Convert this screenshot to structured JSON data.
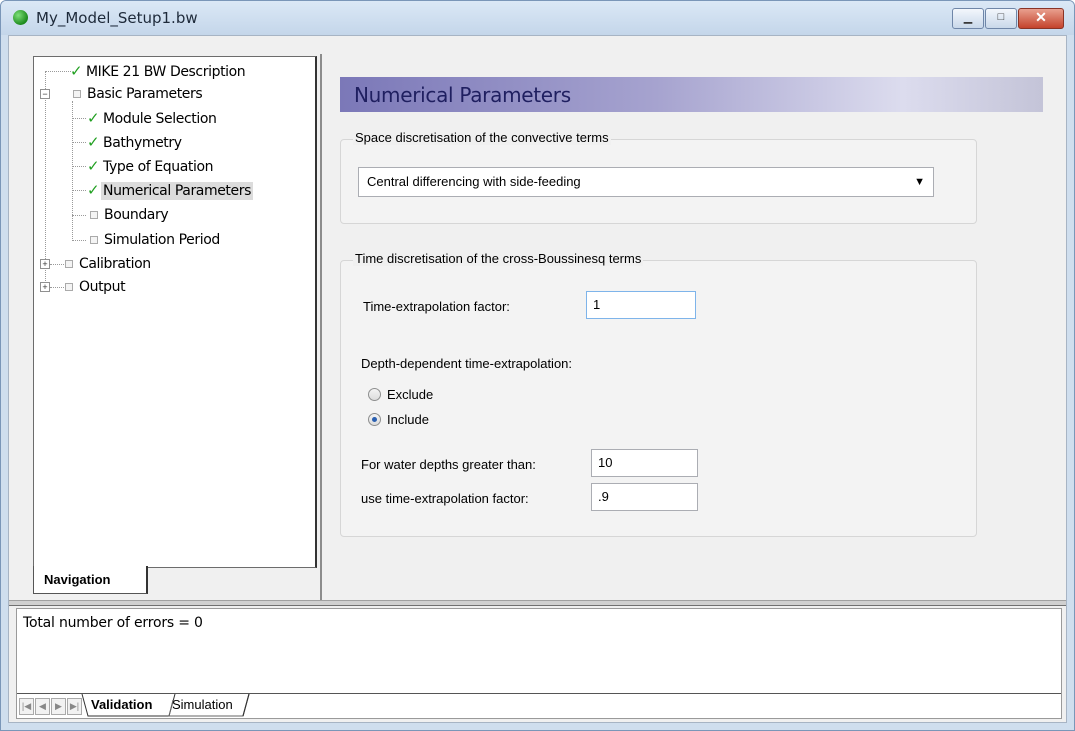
{
  "window": {
    "title": "My_Model_Setup1.bw"
  },
  "nav": {
    "tab_label": "Navigation",
    "tree": [
      {
        "label": "MIKE 21 BW Description",
        "state": "check"
      },
      {
        "label": "Basic Parameters",
        "state": "square"
      },
      {
        "label": "Module Selection",
        "state": "check"
      },
      {
        "label": "Bathymetry",
        "state": "check"
      },
      {
        "label": "Type of Equation",
        "state": "check"
      },
      {
        "label": "Numerical Parameters",
        "state": "check",
        "selected": true
      },
      {
        "label": "Boundary",
        "state": "square"
      },
      {
        "label": "Simulation Period",
        "state": "square"
      },
      {
        "label": "Calibration",
        "state": "square"
      },
      {
        "label": "Output",
        "state": "square"
      }
    ]
  },
  "main": {
    "header": "Numerical Parameters",
    "space_group": {
      "legend": "Space discretisation of the convective terms",
      "selected_option": "Central differencing with side-feeding"
    },
    "time_group": {
      "legend": "Time discretisation of the cross-Boussinesq terms",
      "extrap_label": "Time-extrapolation factor:",
      "extrap_value": "1",
      "depth_label": "Depth-dependent time-extrapolation:",
      "exclude_label": "Exclude",
      "include_label": "Include",
      "depth_selected": "Include",
      "water_depth_label": "For water depths greater than:",
      "water_depth_value": "10",
      "use_factor_label": "use time-extrapolation factor:",
      "use_factor_value": ".9"
    }
  },
  "bottom": {
    "status_text": "Total number of errors = 0",
    "tabs": [
      "Validation",
      "Simulation"
    ]
  }
}
